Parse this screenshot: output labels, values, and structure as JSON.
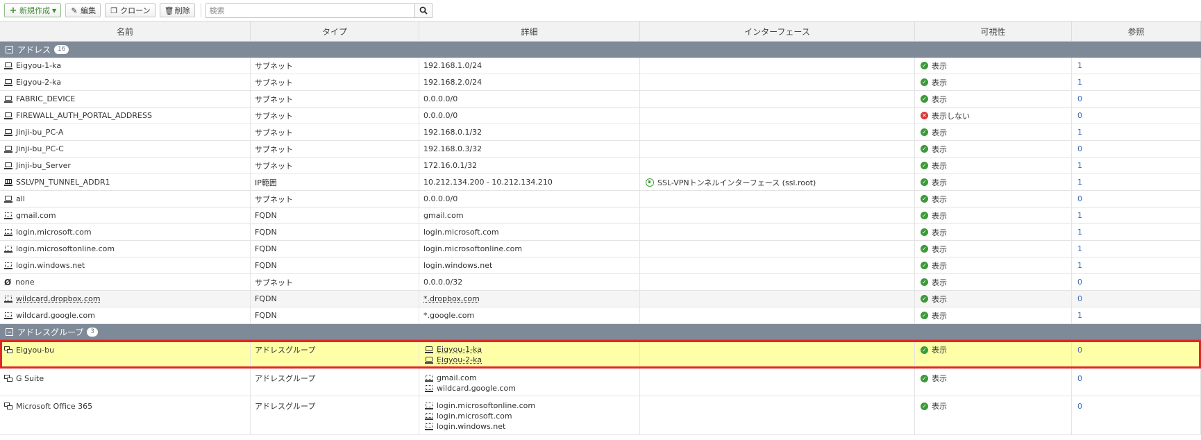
{
  "toolbar": {
    "create_label": "新規作成",
    "edit_label": "編集",
    "clone_label": "クローン",
    "delete_label": "削除",
    "search_placeholder": "検索"
  },
  "columns": {
    "name": "名前",
    "type": "タイプ",
    "details": "詳細",
    "interface": "インターフェース",
    "visibility": "可視性",
    "ref": "参照"
  },
  "groups": {
    "addresses": {
      "label": "アドレス",
      "count": "16"
    },
    "address_groups": {
      "label": "アドレスグループ",
      "count": "3"
    }
  },
  "addresses": [
    {
      "name": "Eigyou-1-ka",
      "type": "サブネット",
      "details": "192.168.1.0/24",
      "interface": "",
      "visibility": "表示",
      "ref": "1"
    },
    {
      "name": "Eigyou-2-ka",
      "type": "サブネット",
      "details": "192.168.2.0/24",
      "interface": "",
      "visibility": "表示",
      "ref": "1"
    },
    {
      "name": "FABRIC_DEVICE",
      "type": "サブネット",
      "details": "0.0.0.0/0",
      "interface": "",
      "visibility": "表示",
      "ref": "0"
    },
    {
      "name": "FIREWALL_AUTH_PORTAL_ADDRESS",
      "type": "サブネット",
      "details": "0.0.0.0/0",
      "interface": "",
      "visibility": "表示しない",
      "ref": "0"
    },
    {
      "name": "Jinji-bu_PC-A",
      "type": "サブネット",
      "details": "192.168.0.1/32",
      "interface": "",
      "visibility": "表示",
      "ref": "1"
    },
    {
      "name": "Jinji-bu_PC-C",
      "type": "サブネット",
      "details": "192.168.0.3/32",
      "interface": "",
      "visibility": "表示",
      "ref": "0"
    },
    {
      "name": "Jinji-bu_Server",
      "type": "サブネット",
      "details": "172.16.0.1/32",
      "interface": "",
      "visibility": "表示",
      "ref": "1"
    },
    {
      "name": "SSLVPN_TUNNEL_ADDR1",
      "type": "IP範囲",
      "details": "10.212.134.200 - 10.212.134.210",
      "interface": "SSL-VPNトンネルインターフェース (ssl.root)",
      "visibility": "表示",
      "ref": "1"
    },
    {
      "name": "all",
      "type": "サブネット",
      "details": "0.0.0.0/0",
      "interface": "",
      "visibility": "表示",
      "ref": "0"
    },
    {
      "name": "gmail.com",
      "type": "FQDN",
      "details": "gmail.com",
      "interface": "",
      "visibility": "表示",
      "ref": "1"
    },
    {
      "name": "login.microsoft.com",
      "type": "FQDN",
      "details": "login.microsoft.com",
      "interface": "",
      "visibility": "表示",
      "ref": "1"
    },
    {
      "name": "login.microsoftonline.com",
      "type": "FQDN",
      "details": "login.microsoftonline.com",
      "interface": "",
      "visibility": "表示",
      "ref": "1"
    },
    {
      "name": "login.windows.net",
      "type": "FQDN",
      "details": "login.windows.net",
      "interface": "",
      "visibility": "表示",
      "ref": "1"
    },
    {
      "name": "none",
      "type": "サブネット",
      "details": "0.0.0.0/32",
      "interface": "",
      "visibility": "表示",
      "ref": "0"
    },
    {
      "name": "wildcard.dropbox.com",
      "type": "FQDN",
      "details": "*.dropbox.com",
      "interface": "",
      "visibility": "表示",
      "ref": "0"
    },
    {
      "name": "wildcard.google.com",
      "type": "FQDN",
      "details": "*.google.com",
      "interface": "",
      "visibility": "表示",
      "ref": "1"
    }
  ],
  "address_groups": [
    {
      "name": "Eigyou-bu",
      "type": "アドレスグループ",
      "members": [
        "Eigyou-1-ka",
        "Eigyou-2-ka"
      ],
      "visibility": "表示",
      "ref": "0"
    },
    {
      "name": "G Suite",
      "type": "アドレスグループ",
      "members": [
        "gmail.com",
        "wildcard.google.com"
      ],
      "visibility": "表示",
      "ref": "0"
    },
    {
      "name": "Microsoft Office 365",
      "type": "アドレスグループ",
      "members": [
        "login.microsoftonline.com",
        "login.microsoft.com",
        "login.windows.net"
      ],
      "visibility": "表示",
      "ref": "0"
    }
  ]
}
